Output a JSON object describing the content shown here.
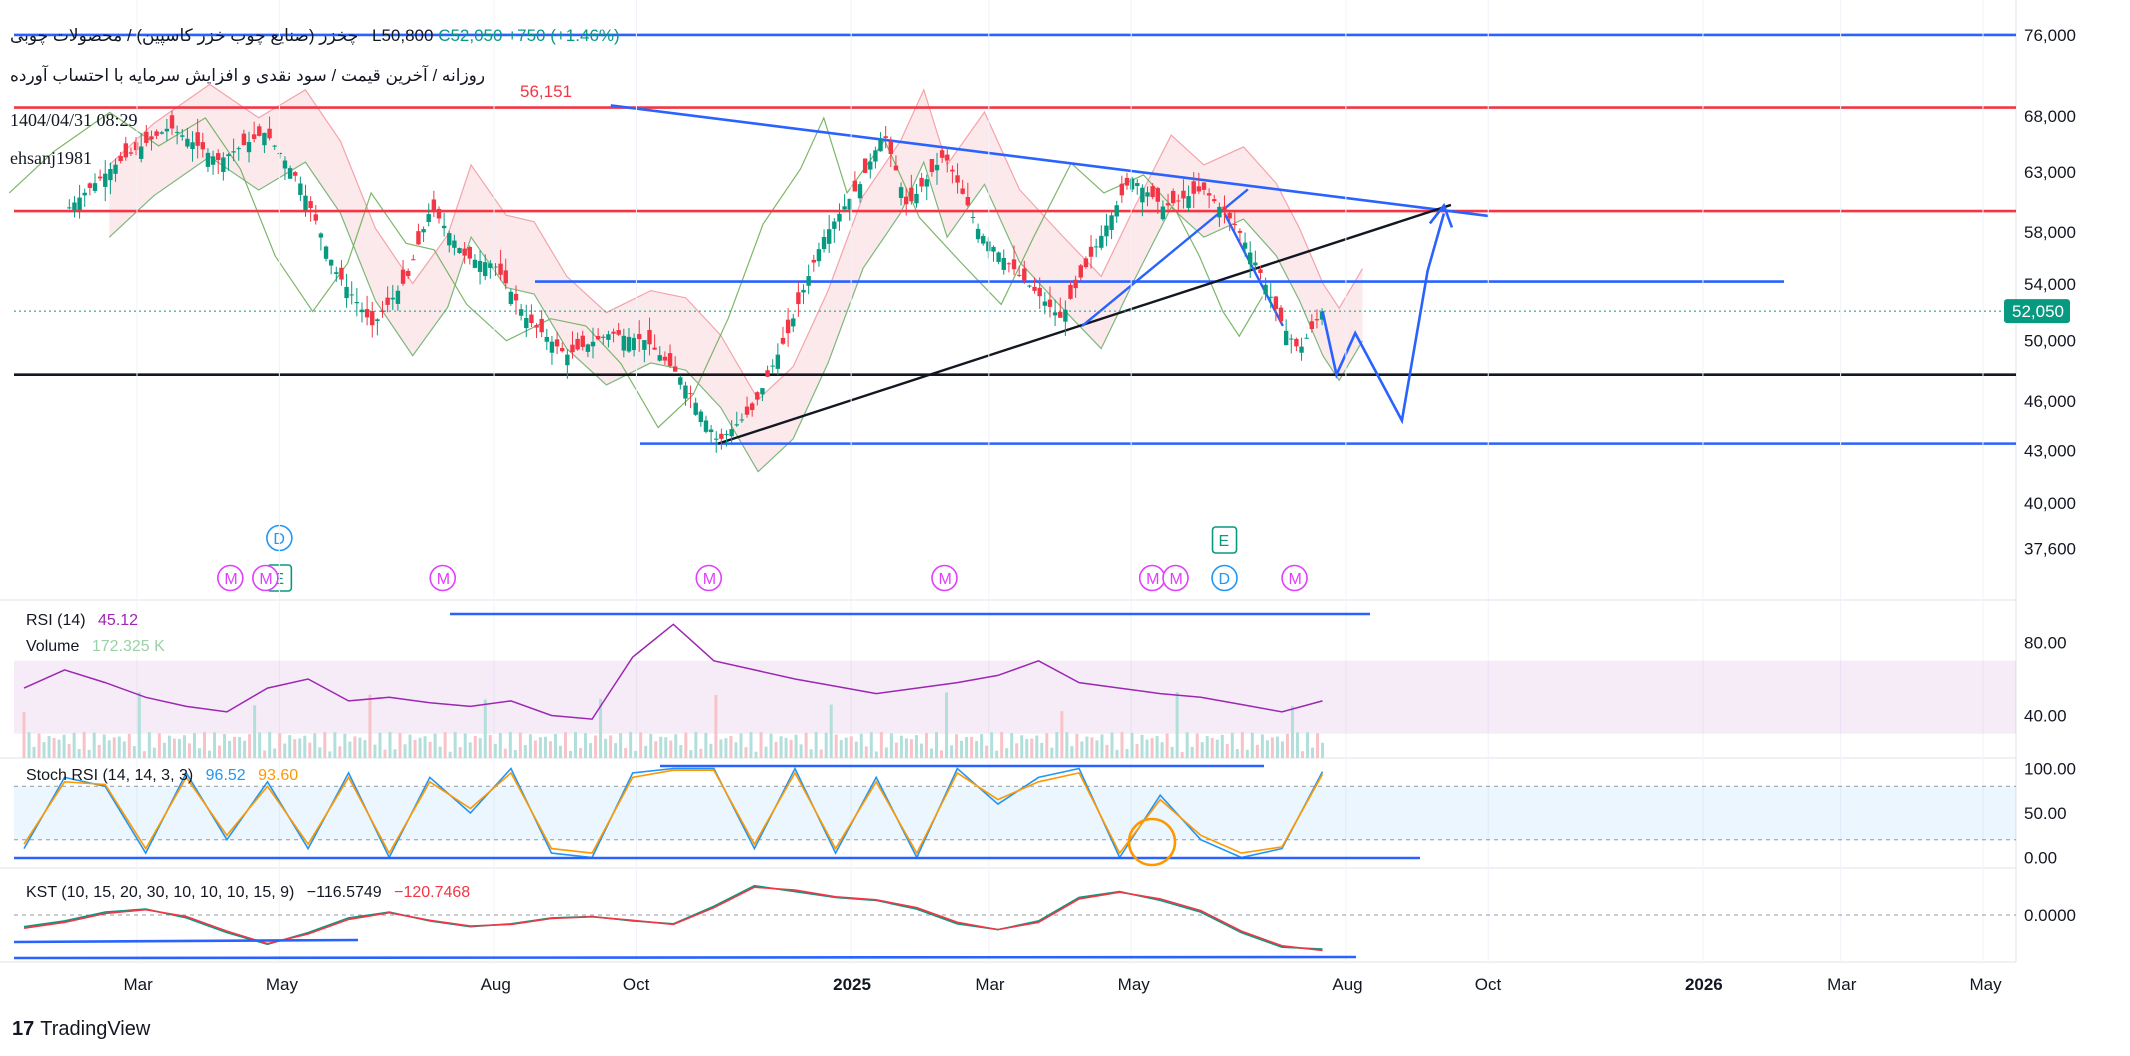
{
  "header": {
    "title": "چخزر (صنایع چوب خزر کاسپین) / محصولات چوبی",
    "subtitle": "روزانه / آخرین قیمت / سود نقدی و افزایش سرمایه با احتساب آورده",
    "low_label": "L50,800",
    "close_label": "C52,050",
    "change_label": "+750 (+1.46%)",
    "datetime": "1404/04/31 08:29",
    "user": "ehsanj1981",
    "overlay_value": "56,151"
  },
  "brand": {
    "name": "TradingView",
    "logo_text": "17"
  },
  "colors": {
    "up": "#089981",
    "down": "#f23645",
    "trend_blue": "#2962ff",
    "rsi": "#9c27b0",
    "stoch_k": "#2196f3",
    "stoch_d": "#ff9800",
    "kst": "#089981",
    "kst_signal": "#f23645",
    "cloud_red": "#f8d7da",
    "cloud_green": "#d4edda",
    "price_badge": "#089981"
  },
  "chart_data": [
    {
      "type": "candlestick",
      "name": "price",
      "y_axis_ticks": [
        "76,000",
        "68,000",
        "63,000",
        "58,000",
        "54,000",
        "50,000",
        "46,000",
        "43,000",
        "40,000",
        "37,600"
      ],
      "y_axis_scale": "log",
      "ylim": [
        36000,
        78000
      ],
      "x_axis_ticks": [
        "Mar",
        "May",
        "Aug",
        "Oct",
        "2025",
        "Mar",
        "May",
        "Aug",
        "Oct",
        "2026",
        "Mar",
        "May"
      ],
      "last_price": 52050,
      "last_price_label": "52,050",
      "path": [
        {
          "x": "2024-02-01",
          "y": 60000
        },
        {
          "x": "2024-02-20",
          "y": 63500
        },
        {
          "x": "2024-03-15",
          "y": 67000
        },
        {
          "x": "2024-04-05",
          "y": 64000
        },
        {
          "x": "2024-04-25",
          "y": 66500
        },
        {
          "x": "2024-05-10",
          "y": 62000
        },
        {
          "x": "2024-05-25",
          "y": 55000
        },
        {
          "x": "2024-06-10",
          "y": 51000
        },
        {
          "x": "2024-06-25",
          "y": 54500
        },
        {
          "x": "2024-07-05",
          "y": 60000
        },
        {
          "x": "2024-07-20",
          "y": 56000
        },
        {
          "x": "2024-08-01",
          "y": 55500
        },
        {
          "x": "2024-08-15",
          "y": 51500
        },
        {
          "x": "2024-09-01",
          "y": 49000
        },
        {
          "x": "2024-09-20",
          "y": 50500
        },
        {
          "x": "2024-10-05",
          "y": 50000
        },
        {
          "x": "2024-10-20",
          "y": 47500
        },
        {
          "x": "2024-11-05",
          "y": 43500
        },
        {
          "x": "2024-11-20",
          "y": 45500
        },
        {
          "x": "2024-12-05",
          "y": 50500
        },
        {
          "x": "2024-12-20",
          "y": 57500
        },
        {
          "x": "2025-01-05",
          "y": 62000
        },
        {
          "x": "2025-01-15",
          "y": 66500
        },
        {
          "x": "2025-01-25",
          "y": 60000
        },
        {
          "x": "2025-02-10",
          "y": 64500
        },
        {
          "x": "2025-02-25",
          "y": 58000
        },
        {
          "x": "2025-03-15",
          "y": 54500
        },
        {
          "x": "2025-04-01",
          "y": 51500
        },
        {
          "x": "2025-04-15",
          "y": 56500
        },
        {
          "x": "2025-05-01",
          "y": 62500
        },
        {
          "x": "2025-05-15",
          "y": 60000
        },
        {
          "x": "2025-06-01",
          "y": 61500
        },
        {
          "x": "2025-06-15",
          "y": 58500
        },
        {
          "x": "2025-06-25",
          "y": 55000
        },
        {
          "x": "2025-07-05",
          "y": 51000
        },
        {
          "x": "2025-07-12",
          "y": 49300
        },
        {
          "x": "2025-07-22",
          "y": 52050
        }
      ],
      "horizontal_lines": [
        {
          "y": 76000,
          "color": "blue"
        },
        {
          "y": 68800,
          "color": "red"
        },
        {
          "y": 59700,
          "color": "red"
        },
        {
          "y": 54200,
          "color": "blue"
        },
        {
          "y": 47700,
          "color": "black"
        },
        {
          "y": 43400,
          "color": "blue"
        }
      ],
      "projection": [
        {
          "x": "2025-07-22",
          "y": 52050
        },
        {
          "x": "2025-07-28",
          "y": 47700
        },
        {
          "x": "2025-08-05",
          "y": 50500
        },
        {
          "x": "2025-08-25",
          "y": 44800
        },
        {
          "x": "2025-09-05",
          "y": 55000
        },
        {
          "x": "2025-09-12",
          "y": 59500
        }
      ],
      "event_markers": [
        {
          "x": "2024-05-01",
          "label": "D"
        },
        {
          "x": "2024-05-01",
          "label": "E"
        },
        {
          "x": "2025-06-10",
          "label": "E"
        },
        {
          "x": "2025-06-10",
          "label": "D"
        },
        {
          "x": "2024-04-10",
          "label": "M"
        },
        {
          "x": "2024-04-25",
          "label": "M"
        },
        {
          "x": "2024-07-10",
          "label": "M"
        },
        {
          "x": "2024-11-01",
          "label": "M"
        },
        {
          "x": "2025-02-10",
          "label": "M"
        },
        {
          "x": "2025-05-10",
          "label": "M"
        },
        {
          "x": "2025-05-20",
          "label": "M"
        },
        {
          "x": "2025-07-10",
          "label": "M"
        }
      ]
    },
    {
      "type": "line",
      "name": "rsi",
      "label": "RSI (14)",
      "value_label": "45.12",
      "y_axis_ticks": [
        "80.00",
        "40.00"
      ],
      "ylim": [
        20,
        100
      ],
      "series": [
        {
          "name": "RSI",
          "values": [
            55,
            65,
            58,
            50,
            45,
            42,
            55,
            60,
            48,
            50,
            47,
            45,
            48,
            40,
            38,
            72,
            90,
            70,
            65,
            60,
            56,
            52,
            55,
            58,
            62,
            70,
            58,
            55,
            52,
            50,
            46,
            42,
            48
          ]
        }
      ]
    },
    {
      "type": "bar",
      "name": "volume",
      "label": "Volume",
      "value_label": "172.325 K"
    },
    {
      "type": "line",
      "name": "stoch_rsi",
      "label": "Stoch RSI (14, 14, 3, 3)",
      "value_label_k": "96.52",
      "value_label_d": "93.60",
      "y_axis_ticks": [
        "100.00",
        "50.00",
        "0.00"
      ],
      "ylim": [
        -5,
        105
      ],
      "series": [
        {
          "name": "K",
          "values": [
            10,
            90,
            80,
            5,
            95,
            20,
            85,
            10,
            95,
            0,
            90,
            50,
            100,
            5,
            0,
            95,
            100,
            100,
            10,
            100,
            5,
            90,
            0,
            100,
            60,
            90,
            100,
            0,
            70,
            20,
            0,
            10,
            96.52
          ]
        },
        {
          "name": "D",
          "values": [
            15,
            85,
            82,
            10,
            90,
            25,
            80,
            15,
            90,
            5,
            85,
            55,
            95,
            10,
            5,
            90,
            98,
            98,
            15,
            95,
            10,
            85,
            5,
            95,
            65,
            85,
            95,
            5,
            65,
            25,
            5,
            12,
            93.6
          ]
        }
      ]
    },
    {
      "type": "line",
      "name": "kst",
      "label": "KST (10, 15, 20, 30, 10, 10, 10, 15, 9)",
      "value_label_kst": "−116.5749",
      "value_label_signal": "−120.7468",
      "y_axis_ticks": [
        "0.0000"
      ],
      "ylim": [
        -140,
        140
      ],
      "series": [
        {
          "name": "KST",
          "values": [
            -40,
            -20,
            10,
            20,
            -10,
            -60,
            -100,
            -60,
            -10,
            10,
            -20,
            -40,
            -30,
            -10,
            -5,
            -20,
            -30,
            30,
            100,
            80,
            60,
            50,
            20,
            -30,
            -50,
            -20,
            60,
            80,
            50,
            10,
            -60,
            -110,
            -116.57
          ]
        },
        {
          "name": "Signal",
          "values": [
            -45,
            -25,
            5,
            18,
            -5,
            -55,
            -98,
            -65,
            -15,
            8,
            -18,
            -38,
            -32,
            -12,
            -6,
            -18,
            -32,
            25,
            95,
            85,
            62,
            52,
            25,
            -25,
            -50,
            -25,
            55,
            78,
            55,
            15,
            -55,
            -105,
            -120.75
          ]
        }
      ]
    }
  ]
}
